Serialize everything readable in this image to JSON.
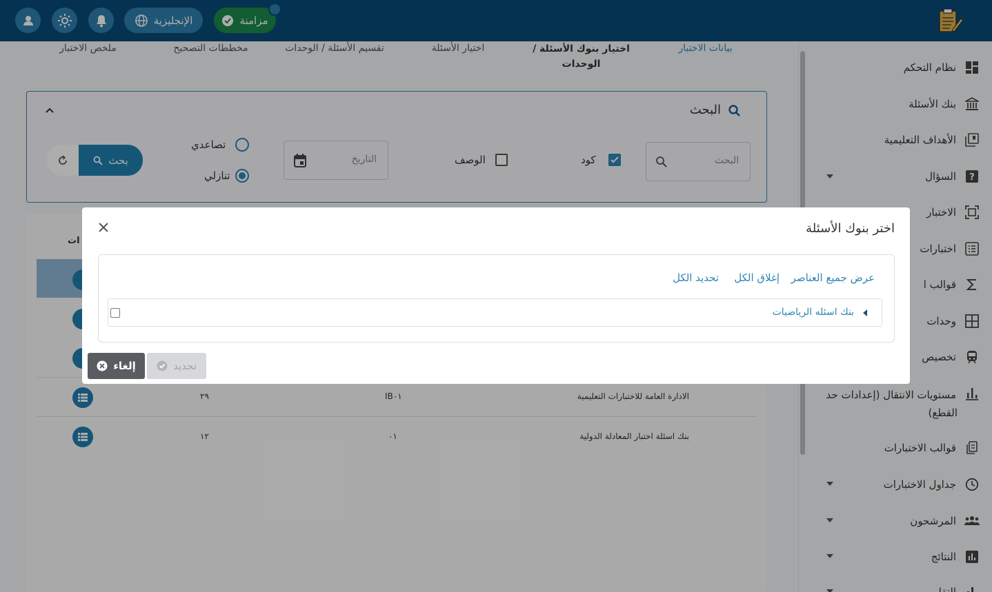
{
  "topbar": {
    "lang_label": "الإنجليزية",
    "sync_label": "مزامنة"
  },
  "colors": {
    "topbar": "#0a4a78",
    "accent": "#2f86b5",
    "sync": "#1b8a4a"
  },
  "steps": [
    "بيانات الاختبار",
    "اختيار بنوك الأسئلة /",
    "الوحدات",
    "اختيار الأسئلة",
    "تقسيم الأسئلة / الوحدات",
    "مخططات التصحيح",
    "ملخص الاختبار"
  ],
  "search": {
    "title": "البحث",
    "placeholder": "البحث",
    "code_label": "كود",
    "code_checked": true,
    "desc_label": "الوصف",
    "desc_checked": false,
    "date_placeholder": "التاريخ",
    "asc_label": "تصاعدي",
    "desc_sort_label": "تنازلي",
    "sort_selected": "تنازلي",
    "search_button": "بحث"
  },
  "table": {
    "partial_header": "ات",
    "rows": [
      {
        "name": "الادارة العامة للاختبارات التعليمية",
        "code": "IB٠١",
        "count": "٢٩"
      },
      {
        "name": "بنك اسئلة اختبار المعادلة الدولية",
        "code": "٠١",
        "count": "١٢"
      }
    ]
  },
  "sidebar": {
    "items": [
      {
        "label": "نظام التحكم",
        "icon": "dashboard-icon",
        "dropdown": false
      },
      {
        "label": "بنك الأسئلة",
        "icon": "bank-icon",
        "dropdown": false
      },
      {
        "label": "الأهداف التعليمية",
        "icon": "book-icon",
        "dropdown": false
      },
      {
        "label": "السؤال",
        "icon": "question-icon",
        "dropdown": true
      },
      {
        "label": "الاختبار",
        "icon": "exam-icon",
        "dropdown": false
      },
      {
        "label": "اختبارات",
        "icon": "list-icon",
        "dropdown": false
      },
      {
        "label": "قوالب ا",
        "icon": "sigma-icon",
        "dropdown": false
      },
      {
        "label": "وحدات",
        "icon": "grid-icon",
        "dropdown": false
      },
      {
        "label": "تخصيص",
        "icon": "train-icon",
        "dropdown": false
      },
      {
        "label": "مستويات الانتقال (إعدادات حد",
        "label2": "القطع)",
        "icon": "bar-chart-icon",
        "dropdown": false
      },
      {
        "label": "قوالب الاختبارات",
        "icon": "copy-icon",
        "dropdown": false
      },
      {
        "label": "جداول الاختبارات",
        "icon": "clock-icon",
        "dropdown": true
      },
      {
        "label": "المرشحون",
        "icon": "people-icon",
        "dropdown": true
      },
      {
        "label": "النتائج",
        "icon": "results-icon",
        "dropdown": true
      },
      {
        "label": "التقارير",
        "icon": "reports-icon",
        "dropdown": true
      }
    ]
  },
  "dialog": {
    "title": "اختر بنوك الأسئلة",
    "show_all": "عرض جميع العناصر",
    "collapse_all": "إغلاق الكل",
    "select_all": "تحديد الكل",
    "tree_item": "بنك اسئله الرياضيات",
    "select_button": "تحديد",
    "cancel_button": "إلغاء"
  }
}
